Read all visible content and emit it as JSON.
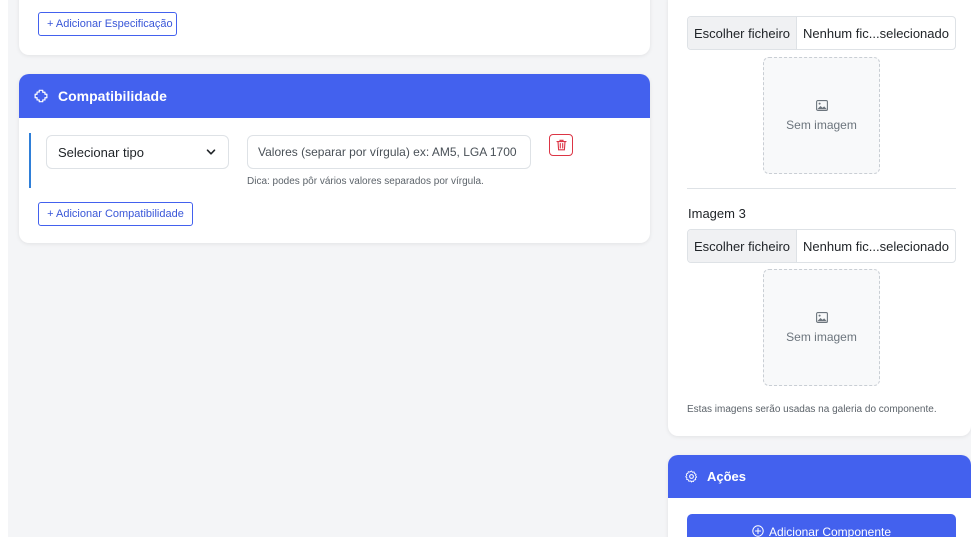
{
  "specifications": {
    "add_label": "+ Adicionar Especificação"
  },
  "compatibility": {
    "title": "Compatibilidade",
    "type_select": {
      "selected": "Selecionar tipo"
    },
    "values_input": {
      "placeholder": "Valores (separar por vírgula) ex: AM5, LGA 1700",
      "value": ""
    },
    "hint": "Dica: podes pôr vários valores separados por vírgula.",
    "add_label": "+ Adicionar Compatibilidade"
  },
  "images": {
    "image2": {
      "file_button": "Escolher ficheiro",
      "file_name": "Nenhum fic...selecionado",
      "placeholder": "Sem imagem"
    },
    "image3": {
      "label": "Imagem 3",
      "file_button": "Escolher ficheiro",
      "file_name": "Nenhum fic...selecionado",
      "placeholder": "Sem imagem"
    },
    "gallery_note": "Estas imagens serão usadas na galeria do componente."
  },
  "actions": {
    "title": "Ações",
    "add_component_label": "Adicionar Componente"
  },
  "icons": {
    "compatibility": "puzzle-icon",
    "chevron": "chevron-down-icon",
    "trash": "trash-icon",
    "image": "image-icon",
    "actions": "gear-icon",
    "add": "plus-circle-icon"
  },
  "colors": {
    "primary": "#4361ee",
    "danger": "#dc3545",
    "accent_bar": "#2f7fd8"
  }
}
